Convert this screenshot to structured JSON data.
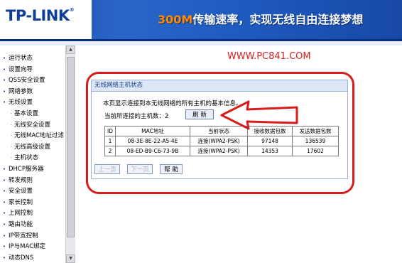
{
  "header": {
    "logo": "TP-LINK",
    "logo_reg": "®",
    "slogan_highlight": "300M",
    "slogan_text": "传输速率，实现无线自由连接梦想"
  },
  "watermark": "WWW.PC841.COM",
  "sidebar": {
    "items": [
      {
        "label": "运行状态",
        "sub": false
      },
      {
        "label": "设置向导",
        "sub": false
      },
      {
        "label": "QSS安全设置",
        "sub": false
      },
      {
        "label": "网络参数",
        "sub": false
      },
      {
        "label": "无线设置",
        "sub": false
      },
      {
        "label": "基本设置",
        "sub": true
      },
      {
        "label": "无线安全设置",
        "sub": true
      },
      {
        "label": "无线MAC地址过滤",
        "sub": true
      },
      {
        "label": "无线高级设置",
        "sub": true
      },
      {
        "label": "主机状态",
        "sub": true
      },
      {
        "label": "DHCP服务器",
        "sub": false
      },
      {
        "label": "转发规则",
        "sub": false
      },
      {
        "label": "安全设置",
        "sub": false
      },
      {
        "label": "家长控制",
        "sub": false
      },
      {
        "label": "上网控制",
        "sub": false
      },
      {
        "label": "路由功能",
        "sub": false
      },
      {
        "label": "IP带宽控制",
        "sub": false
      },
      {
        "label": "IP与MAC绑定",
        "sub": false
      },
      {
        "label": "动态DNS",
        "sub": false
      }
    ]
  },
  "panel": {
    "title": "无线网络主机状态",
    "description": "本页显示连接到本无线网络的所有主机的基本信息。",
    "count_label": "当前所连接的主机数：",
    "count_value": "2",
    "refresh_label": "刷 新",
    "table": {
      "headers": [
        "ID",
        "MAC地址",
        "当前状态",
        "接收数据包数",
        "发送数据包数"
      ],
      "rows": [
        [
          "1",
          "08-3E-8E-22-A5-4E",
          "连接(WPA2-PSK)",
          "97148",
          "136539"
        ],
        [
          "2",
          "08-ED-B9-C6-73-9B",
          "连接(WPA2-PSK)",
          "14353",
          "17602"
        ]
      ]
    },
    "prev_label": "上一页",
    "next_label": "下一页",
    "help_label": "帮 助"
  }
}
